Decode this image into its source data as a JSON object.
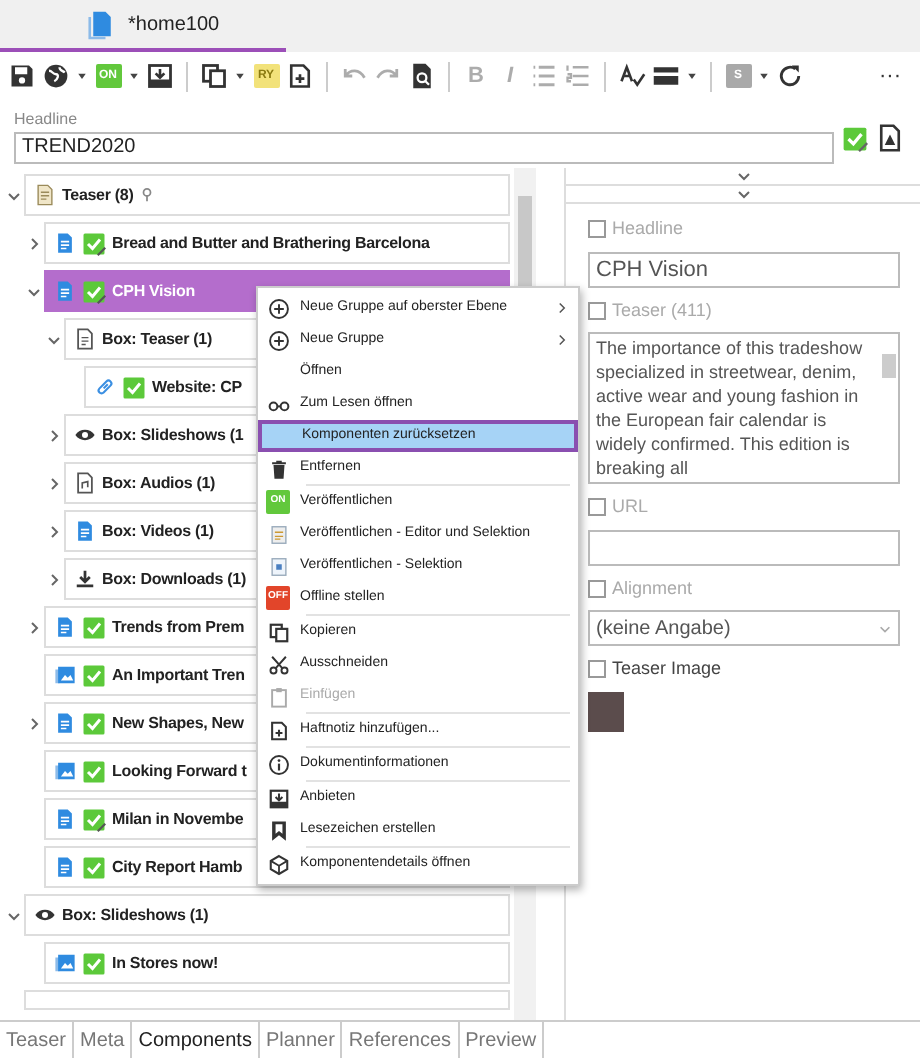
{
  "document_tab": {
    "title": "*home100",
    "selected": true
  },
  "toolbar": [
    {
      "kind": "icon",
      "disabled": false
    },
    {
      "kind": "icon",
      "disabled": false
    },
    {
      "kind": "caret"
    },
    {
      "kind": "badge",
      "text": "ON",
      "color": "#62c83c",
      "disabled": false
    },
    {
      "kind": "caret"
    },
    {
      "kind": "icon",
      "disabled": false
    },
    {
      "kind": "separator"
    },
    {
      "kind": "icon",
      "disabled": false
    },
    {
      "kind": "caret"
    },
    {
      "kind": "badge",
      "text": "RY",
      "color": "#f2e27a",
      "disabled": false
    },
    {
      "kind": "icon",
      "disabled": false
    },
    {
      "kind": "separator"
    },
    {
      "kind": "icon",
      "disabled": true
    },
    {
      "kind": "icon",
      "disabled": true
    },
    {
      "kind": "icon",
      "disabled": false
    },
    {
      "kind": "separator"
    },
    {
      "kind": "text",
      "text": "B",
      "disabled": true
    },
    {
      "kind": "text",
      "text": "I",
      "disabled": true
    },
    {
      "kind": "icon",
      "disabled": true
    },
    {
      "kind": "icon",
      "disabled": true
    },
    {
      "kind": "separator"
    },
    {
      "kind": "icon",
      "disabled": false
    },
    {
      "kind": "icon",
      "disabled": false
    },
    {
      "kind": "caret"
    },
    {
      "kind": "separator"
    },
    {
      "kind": "badge",
      "text": "S",
      "color": "#a9a9a9",
      "disabled": false
    },
    {
      "kind": "caret"
    },
    {
      "kind": "icon",
      "disabled": false
    },
    {
      "kind": "more",
      "text": "···",
      "disabled": false
    }
  ],
  "headline": {
    "label": "Headline",
    "value": "TREND2020"
  },
  "tree": [
    {
      "label": "Teaser (8)",
      "expanded": true,
      "selected": false,
      "approved": false,
      "children": [
        {
          "label": "Bread and Butter and Brathering Barcelona",
          "expanded": false,
          "selected": false,
          "approved": true,
          "edited": true
        },
        {
          "label": "CPH Vision",
          "expanded": true,
          "selected": true,
          "approved": true,
          "edited": true,
          "children": [
            {
              "label": "Box: Teaser (1)",
              "expanded": true,
              "selected": false,
              "approved": false,
              "children": [
                {
                  "label": "Website: CP",
                  "selected": false,
                  "approved": true,
                  "edited": false
                }
              ]
            },
            {
              "label": "Box: Slideshows (1",
              "expanded": false,
              "selected": false,
              "approved": false
            },
            {
              "label": "Box: Audios (1)",
              "expanded": false,
              "selected": false,
              "approved": false
            },
            {
              "label": "Box: Videos (1)",
              "expanded": false,
              "selected": false,
              "approved": false
            },
            {
              "label": "Box: Downloads (1)",
              "expanded": false,
              "selected": false,
              "approved": false
            }
          ]
        },
        {
          "label": "Trends from Prem",
          "expanded": false,
          "selected": false,
          "approved": true,
          "edited": false
        },
        {
          "label": "An Important Tren",
          "selected": false,
          "approved": true,
          "edited": false
        },
        {
          "label": "New Shapes, New",
          "expanded": false,
          "selected": false,
          "approved": true,
          "edited": false
        },
        {
          "label": "Looking Forward t",
          "selected": false,
          "approved": true,
          "edited": false
        },
        {
          "label": "Milan in Novembe",
          "selected": false,
          "approved": true,
          "edited": true
        },
        {
          "label": "City Report Hamb",
          "selected": false,
          "approved": true,
          "edited": false
        }
      ]
    },
    {
      "label": "Box: Slideshows (1)",
      "expanded": true,
      "selected": false,
      "approved": false,
      "children": [
        {
          "label": "In Stores now!",
          "selected": false,
          "approved": true,
          "edited": false
        }
      ]
    }
  ],
  "context_menu": [
    {
      "kind": "item",
      "label": "Neue Gruppe auf oberster Ebene",
      "submenu": true,
      "disabled": false,
      "selected": false
    },
    {
      "kind": "item",
      "label": "Neue Gruppe",
      "submenu": true,
      "disabled": false,
      "selected": false
    },
    {
      "kind": "item",
      "label": "Öffnen",
      "submenu": false,
      "disabled": false,
      "selected": false
    },
    {
      "kind": "item",
      "label": "Zum Lesen öffnen",
      "submenu": false,
      "disabled": false,
      "selected": false
    },
    {
      "kind": "item",
      "label": "Komponenten zurücksetzen",
      "submenu": false,
      "disabled": false,
      "selected": true
    },
    {
      "kind": "item",
      "label": "Entfernen",
      "submenu": false,
      "disabled": false,
      "selected": false
    },
    {
      "kind": "divider"
    },
    {
      "kind": "badge-item",
      "badge": "ON",
      "color": "#62c83c",
      "label": "Veröffentlichen",
      "submenu": false,
      "disabled": false,
      "selected": false
    },
    {
      "kind": "item",
      "label": "Veröffentlichen - Editor und Selektion",
      "submenu": false,
      "disabled": false,
      "selected": false
    },
    {
      "kind": "item",
      "label": "Veröffentlichen - Selektion",
      "submenu": false,
      "disabled": false,
      "selected": false
    },
    {
      "kind": "badge-item",
      "badge": "OFF",
      "color": "#e2452a",
      "label": "Offline stellen",
      "submenu": false,
      "disabled": false,
      "selected": false
    },
    {
      "kind": "divider"
    },
    {
      "kind": "item",
      "label": "Kopieren",
      "submenu": false,
      "disabled": false,
      "selected": false
    },
    {
      "kind": "item",
      "label": "Ausschneiden",
      "submenu": false,
      "disabled": false,
      "selected": false
    },
    {
      "kind": "item",
      "label": "Einfügen",
      "submenu": false,
      "disabled": true,
      "selected": false
    },
    {
      "kind": "divider"
    },
    {
      "kind": "item",
      "label": "Haftnotiz hinzufügen...",
      "submenu": false,
      "disabled": false,
      "selected": false
    },
    {
      "kind": "divider"
    },
    {
      "kind": "item",
      "label": "Dokumentinformationen",
      "submenu": false,
      "disabled": false,
      "selected": false
    },
    {
      "kind": "divider"
    },
    {
      "kind": "item",
      "label": "Anbieten",
      "submenu": false,
      "disabled": false,
      "selected": false
    },
    {
      "kind": "item",
      "label": "Lesezeichen erstellen",
      "submenu": false,
      "disabled": false,
      "selected": false
    },
    {
      "kind": "divider"
    },
    {
      "kind": "item",
      "label": "Komponentendetails öffnen",
      "submenu": false,
      "disabled": false,
      "selected": false
    }
  ],
  "properties": [
    {
      "kind": "input",
      "label": "Headline",
      "checked": false,
      "value": "CPH Vision"
    },
    {
      "kind": "textarea",
      "label": "Teaser (411)",
      "checked": false,
      "value": "The importance of this tradeshow specialized in streetwear, denim, active wear and young fashion in the European fair calendar is widely confirmed. This edition is breaking all"
    },
    {
      "kind": "input",
      "label": "URL",
      "checked": false
    },
    {
      "kind": "select",
      "label": "Alignment",
      "checked": false,
      "value": "(keine Angabe)"
    },
    {
      "kind": "image",
      "label": "Teaser Image",
      "checked": false
    }
  ],
  "bottom_tabs": [
    {
      "label": "Teaser",
      "selected": false
    },
    {
      "label": "Meta",
      "selected": false
    },
    {
      "label": "Components",
      "selected": true
    },
    {
      "label": "Planner",
      "selected": false
    },
    {
      "label": "References",
      "selected": false
    },
    {
      "label": "Preview",
      "selected": false
    }
  ]
}
